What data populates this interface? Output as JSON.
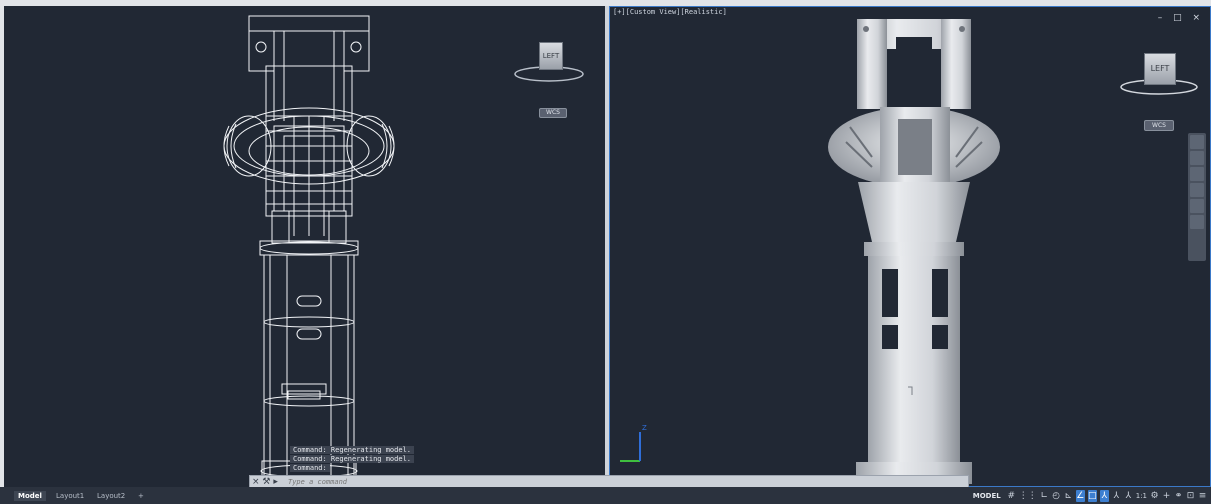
{
  "viewports": {
    "left": {
      "viewcube_face": "LEFT",
      "wcs_label": "WCS",
      "command_history": [
        "Command:  Regenerating model.",
        "Command:  Regenerating model.",
        "Command:"
      ]
    },
    "right": {
      "label": "[+][Custom View][Realistic]",
      "viewcube_face": "LEFT",
      "wcs_label": "WCS",
      "window_controls": "– □ ×"
    }
  },
  "command_line": {
    "placeholder": "Type a command",
    "close_icon": "×",
    "wrench_icon": "⚒",
    "prompt_icon": "▸"
  },
  "layout_tabs": [
    "Model",
    "Layout1",
    "Layout2",
    "+"
  ],
  "status_bar": {
    "model_label": "MODEL",
    "scale_label": "1:1",
    "icons": [
      "grid-icon",
      "snap-icon",
      "ortho-icon",
      "polar-icon",
      "isodraft-icon",
      "osnap-icon",
      "otrack-icon",
      "annotation-icon",
      "annovisibility-icon",
      "autoscale-icon",
      "gear-icon",
      "plus-icon",
      "workspace-icon",
      "fullscreen-icon",
      "menu-icon"
    ]
  },
  "colors": {
    "viewport_bg": "#212834",
    "active_border": "#3b79c8",
    "status_bg": "#2b323e",
    "wireframe": "#f2f4f7"
  }
}
